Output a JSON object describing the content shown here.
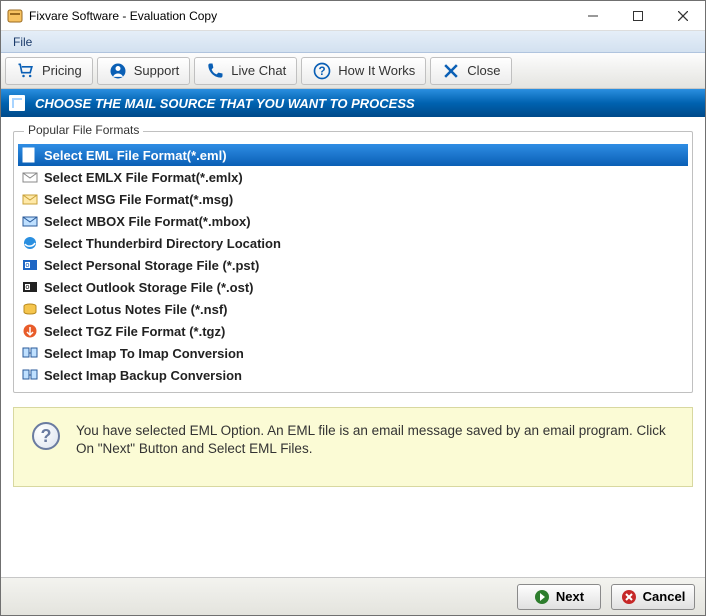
{
  "window": {
    "title": "Fixvare Software - Evaluation Copy"
  },
  "menubar": {
    "file": "File"
  },
  "toolbar": {
    "pricing": "Pricing",
    "support": "Support",
    "livechat": "Live Chat",
    "howitworks": "How It Works",
    "close": "Close"
  },
  "header": {
    "text": "CHOOSE THE MAIL SOURCE THAT YOU WANT TO PROCESS"
  },
  "group": {
    "title": "Popular File Formats"
  },
  "formats": [
    {
      "label": "Select EML File Format(*.eml)",
      "icon": "eml",
      "selected": true
    },
    {
      "label": "Select EMLX File Format(*.emlx)",
      "icon": "emlx",
      "selected": false
    },
    {
      "label": "Select MSG File Format(*.msg)",
      "icon": "msg",
      "selected": false
    },
    {
      "label": "Select MBOX File Format(*.mbox)",
      "icon": "mbox",
      "selected": false
    },
    {
      "label": "Select Thunderbird Directory Location",
      "icon": "tb",
      "selected": false
    },
    {
      "label": "Select Personal Storage File (*.pst)",
      "icon": "pst",
      "selected": false
    },
    {
      "label": "Select Outlook Storage File (*.ost)",
      "icon": "ost",
      "selected": false
    },
    {
      "label": "Select Lotus Notes File (*.nsf)",
      "icon": "nsf",
      "selected": false
    },
    {
      "label": "Select TGZ File Format (*.tgz)",
      "icon": "tgz",
      "selected": false
    },
    {
      "label": "Select Imap To Imap Conversion",
      "icon": "imap",
      "selected": false
    },
    {
      "label": "Select Imap Backup Conversion",
      "icon": "imap",
      "selected": false
    }
  ],
  "info": {
    "text": "You have selected EML Option. An EML file is an email message saved by an email program. Click On \"Next\" Button and Select EML Files."
  },
  "buttons": {
    "next": "Next",
    "cancel": "Cancel"
  },
  "colors": {
    "accent_blue": "#0a5fb5",
    "info_bg": "#fbfbd5"
  }
}
